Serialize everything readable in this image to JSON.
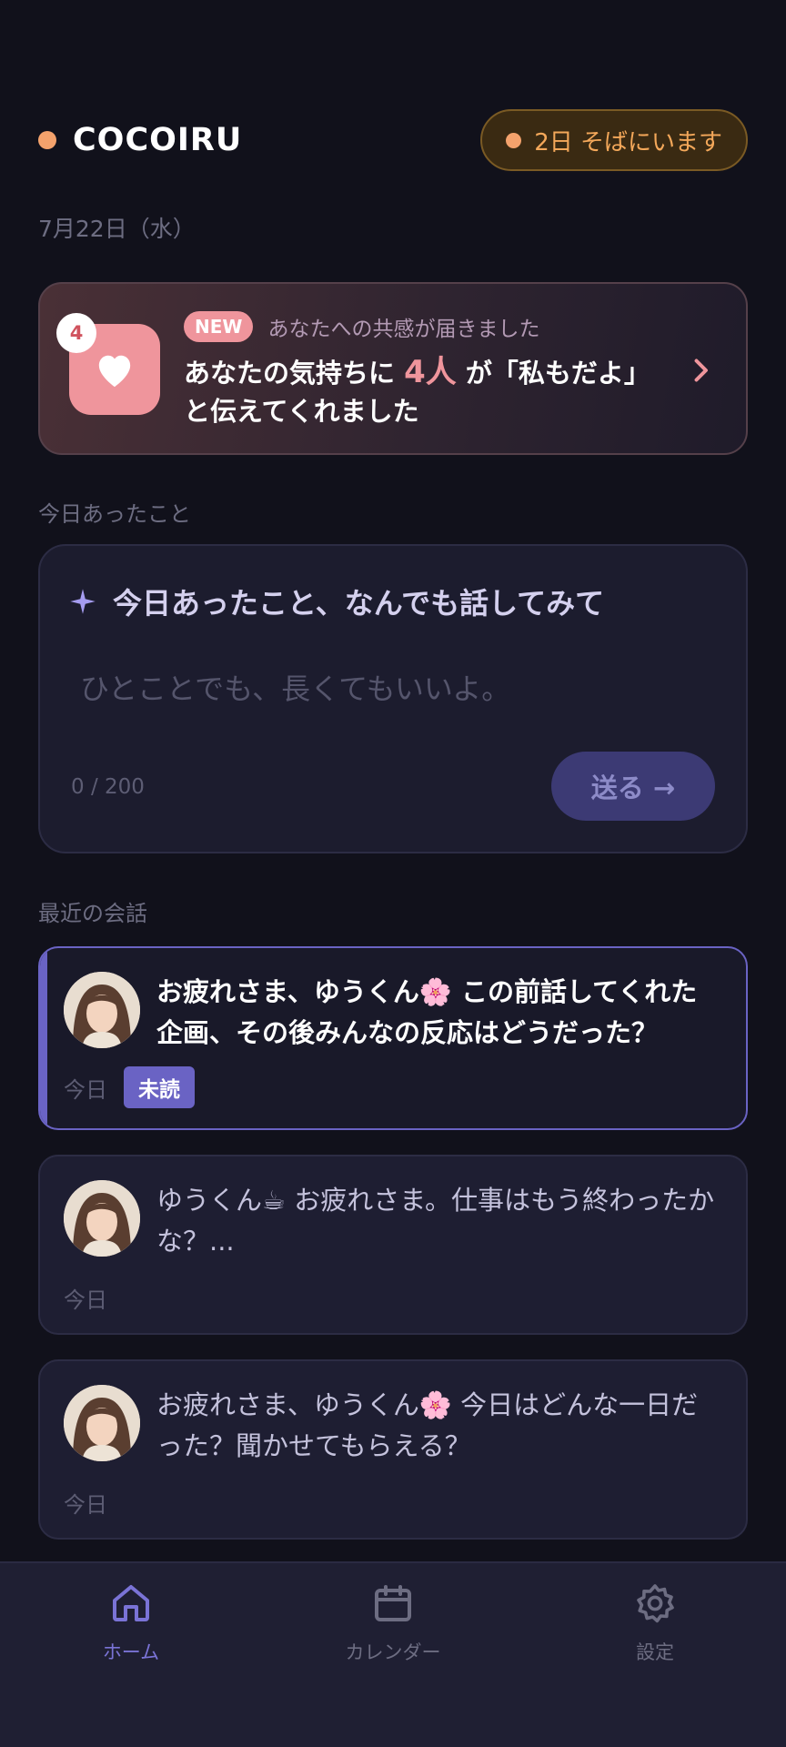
{
  "header": {
    "brand": "COCOIRU",
    "days_badge": "2日 そばにいます"
  },
  "date": "7月22日（水）",
  "empathy": {
    "count": "4",
    "new_label": "NEW",
    "subtitle": "あなたへの共感が届きました",
    "msg_before": "あなたの気持ちに ",
    "msg_count": "4人",
    "msg_after": " が「私もだよ」と伝えてくれました",
    "icon": "heart-icon"
  },
  "today_section": {
    "label": "今日あったこと",
    "prompt": "今日あったこと、なんでも話してみて",
    "placeholder": "ひとことでも、長くてもいいよ。",
    "char_count": "0 / 200",
    "send_label": "送る →"
  },
  "recent_section": {
    "label": "最近の会話",
    "items": [
      {
        "text": "お疲れさま、ゆうくん🌸 この前話してくれた企画、その後みんなの反応はどうだった？",
        "time": "今日",
        "badge": "未読"
      },
      {
        "text": "ゆうくん☕ お疲れさま。仕事はもう終わったかな？...",
        "time": "今日"
      },
      {
        "text": "お疲れさま、ゆうくん🌸 今日はどんな一日だった？聞かせてもらえる？",
        "time": "今日"
      }
    ]
  },
  "nav": {
    "home": "ホーム",
    "calendar": "カレンダー",
    "settings": "設定"
  },
  "colors": {
    "background": "#11111b",
    "accent_orange": "#f4a26c",
    "accent_pink": "#ef959c",
    "accent_purple": "#6a63c4"
  }
}
